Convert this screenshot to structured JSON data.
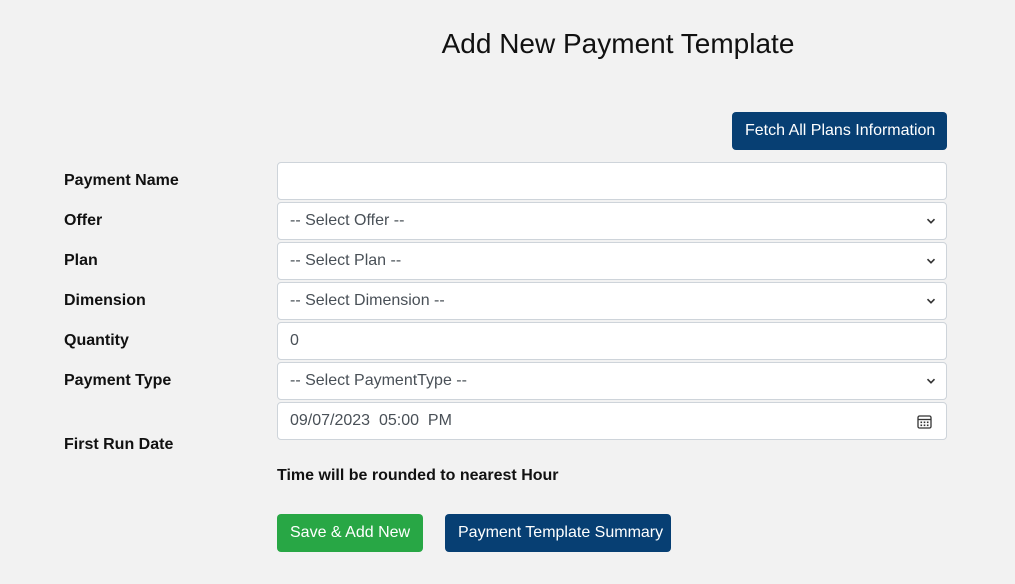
{
  "page": {
    "title": "Add New Payment Template"
  },
  "toolbar": {
    "fetch_label": "Fetch All Plans Information"
  },
  "form": {
    "payment_name": {
      "label": "Payment Name",
      "value": ""
    },
    "offer": {
      "label": "Offer",
      "selected": "-- Select Offer --"
    },
    "plan": {
      "label": "Plan",
      "selected": "-- Select Plan --"
    },
    "dimension": {
      "label": "Dimension",
      "selected": "-- Select Dimension --"
    },
    "quantity": {
      "label": "Quantity",
      "value": "0"
    },
    "payment_type": {
      "label": "Payment Type",
      "selected": "-- Select PaymentType --"
    },
    "first_run_date": {
      "label": "First Run Date",
      "value": "09/07/2023  05:00  PM"
    },
    "note": "Time will be rounded to nearest Hour"
  },
  "actions": {
    "save_label": "Save & Add New",
    "summary_label": "Payment Template Summary"
  },
  "colors": {
    "primary": "#073f73",
    "success": "#28a745",
    "background": "#f2f2f2"
  },
  "icons": {
    "select_arrow": "chevron-down-icon",
    "date_picker": "calendar-icon"
  }
}
